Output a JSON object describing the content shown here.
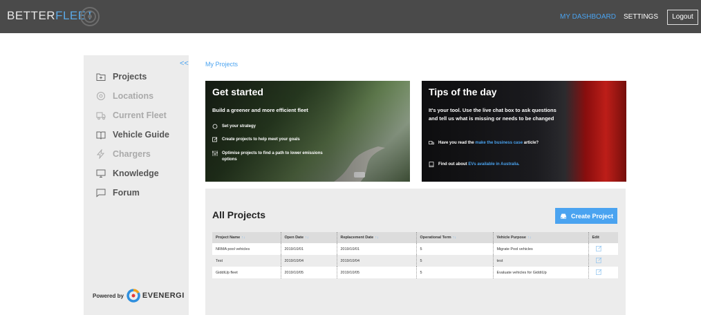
{
  "header": {
    "brand_part1": "BETTER",
    "brand_part2": "FLEET",
    "nav": {
      "dashboard": "MY DASHBOARD",
      "settings": "SETTINGS",
      "logout": "Logout"
    }
  },
  "sidebar": {
    "collapse": "<<",
    "items": [
      {
        "label": "Projects",
        "icon": "folder-plus-icon",
        "active": true
      },
      {
        "label": "Locations",
        "icon": "location-pin-icon",
        "active": false
      },
      {
        "label": "Current Fleet",
        "icon": "truck-icon",
        "active": false
      },
      {
        "label": "Vehicle Guide",
        "icon": "book-icon",
        "active": true
      },
      {
        "label": "Chargers",
        "icon": "lightning-icon",
        "active": false
      },
      {
        "label": "Knowledge",
        "icon": "monitor-icon",
        "active": true
      },
      {
        "label": "Forum",
        "icon": "chat-icon",
        "active": true
      }
    ],
    "powered_by": "Powered by",
    "powered_brand": "EVENERGI"
  },
  "breadcrumb": "My Projects",
  "get_started": {
    "title": "Get started",
    "subtitle": "Build a greener and more efficient fleet",
    "bullets": [
      "Set your strategy",
      "Create projects to help meet your goals",
      "Optimise projects to find a path to lower emissions options"
    ]
  },
  "tips": {
    "title": "Tips of the day",
    "subtitle": "It's your tool. Use the live chat box to ask questions and tell us what is missing or needs to be changed",
    "tip1_pre": "Have you read the ",
    "tip1_link": "make the business case",
    "tip1_post": " article?",
    "tip2_pre": "Find out about ",
    "tip2_link": "EVs available in Australia."
  },
  "projects": {
    "title": "All Projects",
    "create_label": "Create Project",
    "columns": [
      "Project Name",
      "Open Date",
      "Replacement Date",
      "Operational Term",
      "Vehicle Purpose",
      "Edit"
    ],
    "sort_glyph": "↑↓",
    "rows": [
      [
        "NRMA pool vehicles",
        "2019/10/01",
        "2019/10/01",
        "5",
        "Migrate Pool vehicles"
      ],
      [
        "Test",
        "2019/10/04",
        "2019/10/04",
        "5",
        "test"
      ],
      [
        "GiddiUp fleet",
        "2019/10/05",
        "2019/10/05",
        "5",
        "Evaluate vehicles for GiddiUp"
      ]
    ]
  },
  "colors": {
    "accent": "#4aa3f0",
    "topbar": "#4a4a4a",
    "sidebar": "#ececec"
  }
}
